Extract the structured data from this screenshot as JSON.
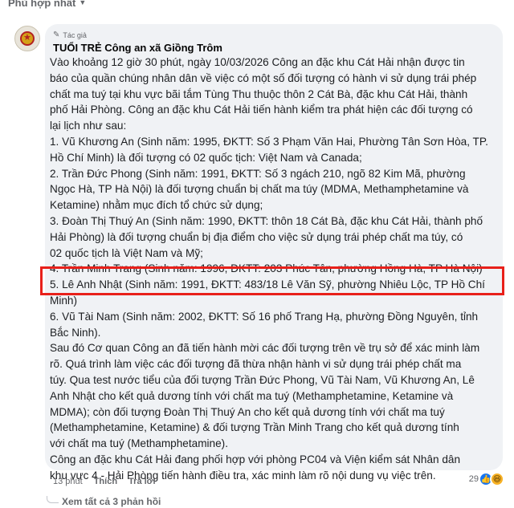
{
  "sort": {
    "label": "Phù hợp nhất"
  },
  "comment": {
    "badge": "Tác giả",
    "author": "TUỔI TRẺ Công an xã Giồng Trôm",
    "lines": [
      "Vào khoảng 12 giờ 30 phút, ngày 10/03/2026 Công an đặc khu Cát Hải nhận được tin",
      "báo của quần chúng nhân dân về việc có một số đối tượng có hành vi sử dụng trái phép",
      "chất ma tuý tại khu vực bãi tắm Tùng Thu thuộc thôn 2 Cát Bà, đặc khu Cát Hải, thành",
      "phố Hải Phòng. Công an đặc khu Cát Hải tiến hành kiểm tra phát hiện các đối tượng có",
      "lại lịch như sau:",
      "1. Vũ Khương An (Sinh năm: 1995, ĐKTT: Số 3 Phạm Văn Hai, Phường Tân Sơn Hòa, TP.",
      "Hồ Chí Minh) là đối tượng có 02 quốc tịch: Việt Nam và Canada;",
      "2. Trần Đức Phong (Sinh năm: 1991, ĐKTT: Số 3 ngách 210, ngõ 82 Kim Mã, phường",
      "Ngọc Hà, TP Hà Nội) là đối tượng chuẩn bị chất ma túy (MDMA, Methamphetamine và",
      "Ketamine) nhằm mục đích tổ chức sử dụng;",
      "3. Đoàn Thị Thuý An (Sinh năm: 1990, ĐKTT: thôn 18 Cát Bà, đặc khu Cát Hải, thành phố",
      "Hải Phòng) là đối tượng chuẩn bị địa điểm cho việc sử dụng trái phép chất ma túy, có",
      "02 quốc tịch là Việt Nam và Mỹ;",
      "4. Trần Minh Trang (Sinh năm: 1996, ĐKTT: 203 Phúc Tân, phường Hồng Hà, TP Hà Nội)",
      "5. Lê Anh Nhật (Sinh năm: 1991, ĐKTT: 483/18 Lê Văn Sỹ, phường Nhiêu Lộc, TP Hồ Chí",
      "Minh)",
      "6. Vũ Tài Nam (Sinh năm: 2002, ĐKTT: Số 16 phố Trang Hạ, phường Đồng Nguyên, tỉnh",
      "Bắc Ninh).",
      "Sau đó Cơ quan Công an đã tiến hành mời các đối tượng trên về trụ sở để xác minh làm",
      "rõ. Quá trình làm việc các đối tượng đã thừa nhận hành vi sử dụng trái phép chất ma",
      "túy. Qua test nước tiểu của đối tượng Trần Đức Phong, Vũ Tài Nam, Vũ Khương An, Lê",
      "Anh Nhật cho kết quả dương tính với chất ma tuý (Methamphetamine, Ketamine và",
      "MDMA); còn đối tượng Đoàn Thị Thuý An cho kết quả dương tính với chất ma tuý",
      "(Methamphetamine, Ketamine) & đối tượng Trần Minh Trang cho kết quả dương tính",
      "với chất ma tuý (Methamphetamine).",
      "Công an đặc khu Cát Hải đang phối hợp với phòng PC04 và Viện kiểm sát Nhân dân",
      "khu vực 4 - Hải Phòng tiến hành điều tra, xác minh làm rõ nội dung vụ việc trên."
    ]
  },
  "actions": {
    "time": "13 phút",
    "like": "Thích",
    "reply": "Trả lời"
  },
  "reactions": {
    "count": "29",
    "icons": [
      "like-icon",
      "haha-icon"
    ]
  },
  "replies": {
    "label": "Xem tất cả 3 phản hồi"
  },
  "colors": {
    "highlight": "#e8201a",
    "bubble": "#f0f2f5",
    "like": "#1877f2"
  }
}
